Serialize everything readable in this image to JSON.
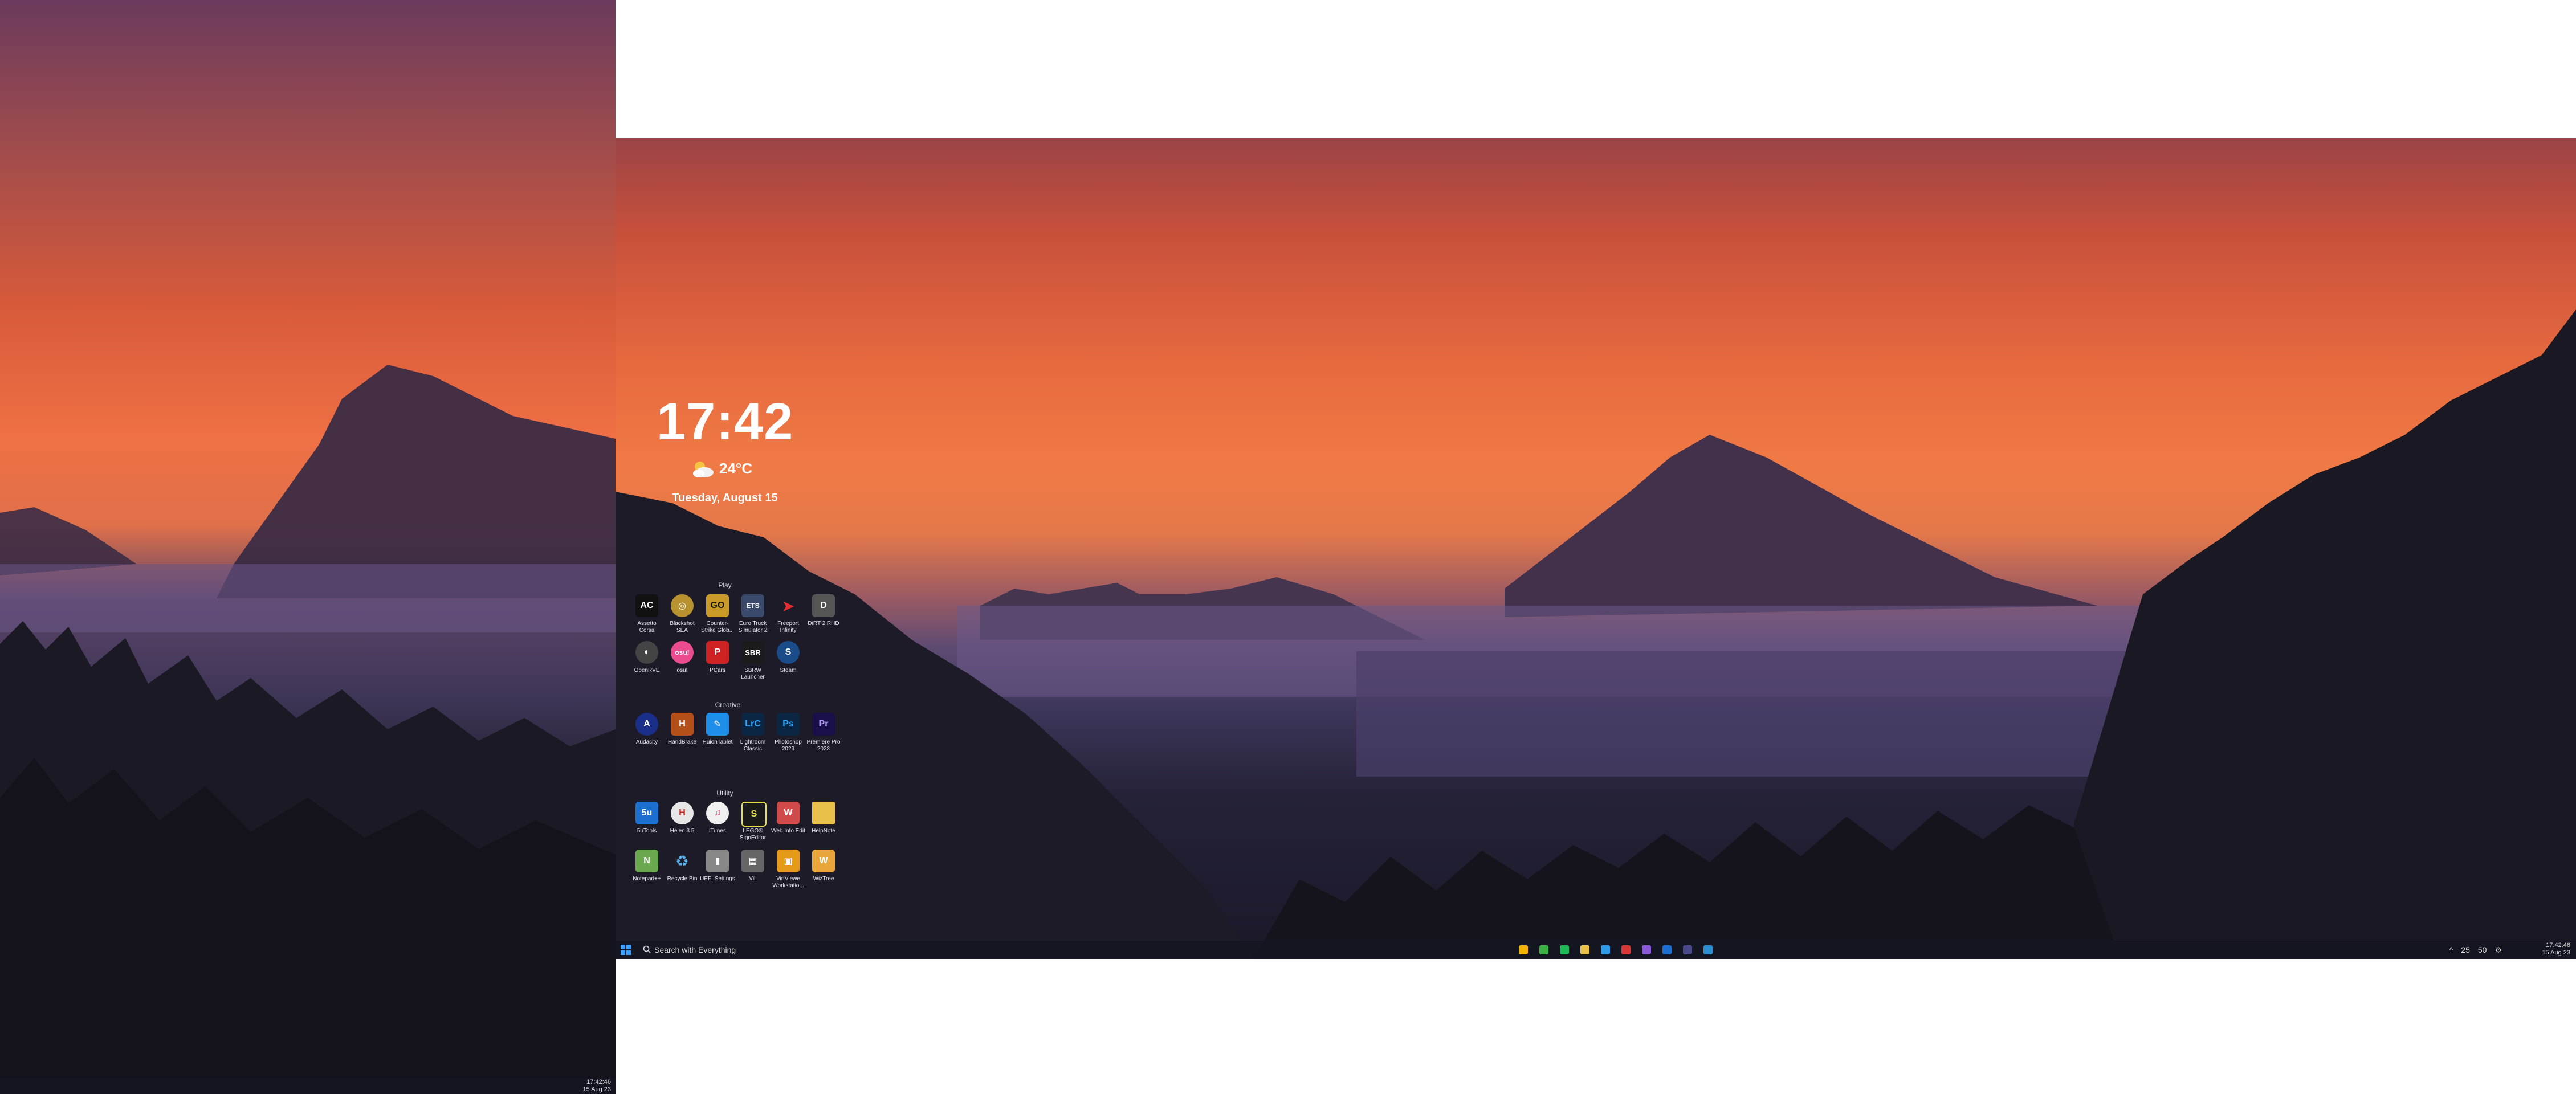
{
  "widget": {
    "time": "17:42",
    "temperature": "24°C",
    "date": "Tuesday, August 15"
  },
  "groups": [
    {
      "title": "Play",
      "apps": [
        {
          "label": "Assetto Corsa",
          "icon": "assetto-corsa-icon",
          "color": "#111111",
          "glyph": "AC"
        },
        {
          "label": "Blackshot SEA",
          "icon": "blackshot-icon",
          "color": "#b8922f",
          "glyph": "◎"
        },
        {
          "label": "Counter-Strike Glob...",
          "icon": "csgo-icon",
          "color": "#c99a28",
          "glyph": "GO"
        },
        {
          "label": "Euro Truck Simulator 2",
          "icon": "ets2-icon",
          "color": "#3a4a6a",
          "glyph": "ETS"
        },
        {
          "label": "Freeport Infinity",
          "icon": "freeport-icon",
          "color": "#b91b1b",
          "glyph": "➤"
        },
        {
          "label": "DiRT 2 RHD",
          "icon": "dirt-icon",
          "color": "#555555",
          "glyph": "D"
        },
        {
          "label": "OpenRVE",
          "icon": "openrve-icon",
          "color": "#444444",
          "glyph": "◐"
        },
        {
          "label": "osu!",
          "icon": "osu-icon",
          "color": "#ea4c8f",
          "glyph": "osu!"
        },
        {
          "label": "PCars",
          "icon": "pcars-icon",
          "color": "#cc2222",
          "glyph": "P"
        },
        {
          "label": "SBRW Launcher",
          "icon": "sbrw-icon",
          "color": "#1b1b1b",
          "glyph": "SBR"
        },
        {
          "label": "Steam",
          "icon": "steam-icon",
          "color": "#1b4c8a",
          "glyph": "S"
        }
      ]
    },
    {
      "title": "Creative",
      "apps": [
        {
          "label": "Audacity",
          "icon": "audacity-icon",
          "color": "#1a2f8a",
          "glyph": "A"
        },
        {
          "label": "HandBrake",
          "icon": "handbrake-icon",
          "color": "#b3501a",
          "glyph": "H"
        },
        {
          "label": "HuionTablet",
          "icon": "huion-icon",
          "color": "#1e8ee8",
          "glyph": "✎"
        },
        {
          "label": "Lightroom Classic",
          "icon": "lightroom-icon",
          "color": "#0a2642",
          "glyph": "LrC"
        },
        {
          "label": "Photoshop 2023",
          "icon": "photoshop-icon",
          "color": "#0a2642",
          "glyph": "Ps"
        },
        {
          "label": "Premiere Pro 2023",
          "icon": "premiere-icon",
          "color": "#1b0f4a",
          "glyph": "Pr"
        }
      ]
    },
    {
      "title": "Utility",
      "apps": [
        {
          "label": "5uTools",
          "icon": "5utools-icon",
          "color": "#1b6fd1",
          "glyph": "5u"
        },
        {
          "label": "Helen 3.5",
          "icon": "helen-icon",
          "color": "#e6e6e6",
          "glyph": "H"
        },
        {
          "label": "iTunes",
          "icon": "itunes-icon",
          "color": "#f0f0f0",
          "glyph": "♫"
        },
        {
          "label": "LEGO® SignEditor",
          "icon": "signeditor-icon",
          "color": "#1a1a1a",
          "glyph": "S"
        },
        {
          "label": "Web Info Edit",
          "icon": "webinfo-icon",
          "color": "#d04a4a",
          "glyph": "W"
        },
        {
          "label": "HelpNote",
          "icon": "folder-icon",
          "color": "#e8c04a",
          "glyph": ""
        },
        {
          "label": "Notepad++",
          "icon": "notepadpp-icon",
          "color": "#6aa84f",
          "glyph": "N"
        },
        {
          "label": "Recycle Bin",
          "icon": "recycle-bin-icon",
          "color": "#2a8fd1",
          "glyph": "♻"
        },
        {
          "label": "UEFI Settings",
          "icon": "uefi-icon",
          "color": "#888888",
          "glyph": "▮"
        },
        {
          "label": "Vili",
          "icon": "vili-icon",
          "color": "#666666",
          "glyph": "▤"
        },
        {
          "label": "VirtViewe Workstatio...",
          "icon": "vmware-icon",
          "color": "#e59a1a",
          "glyph": "▣"
        },
        {
          "label": "WizTree",
          "icon": "wiztree-icon",
          "color": "#e8a53a",
          "glyph": "W"
        }
      ]
    }
  ],
  "taskbar_main": {
    "search_placeholder": "Search with Everything",
    "tray_text_1": "25",
    "tray_text_2": "50",
    "time": "17:42:46",
    "date": "15 Aug 23"
  },
  "taskbar_left": {
    "time": "17:42:46",
    "date": "15 Aug 23"
  },
  "pinned_colors": [
    "#f4b400",
    "#3cb043",
    "#1db954",
    "#e8c04a",
    "#2f9be8",
    "#d93636",
    "#8a5ad6",
    "#1a6fd1",
    "#4a4a8a",
    "#2a8fd1"
  ]
}
